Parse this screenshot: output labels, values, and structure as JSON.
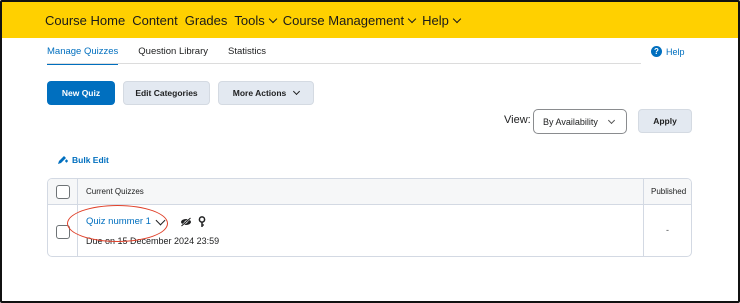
{
  "nav": {
    "items": [
      {
        "label": "Course Home",
        "dropdown": false
      },
      {
        "label": "Content",
        "dropdown": false
      },
      {
        "label": "Grades",
        "dropdown": false
      },
      {
        "label": "Tools",
        "dropdown": true
      },
      {
        "label": "Course Management",
        "dropdown": true
      },
      {
        "label": "Help",
        "dropdown": true
      }
    ]
  },
  "tabs": [
    {
      "label": "Manage Quizzes",
      "active": true
    },
    {
      "label": "Question Library",
      "active": false
    },
    {
      "label": "Statistics",
      "active": false
    }
  ],
  "help": {
    "label": "Help",
    "icon": "question-circle-icon"
  },
  "toolbar": {
    "new_quiz": "New Quiz",
    "edit_categories": "Edit Categories",
    "more_actions": "More Actions"
  },
  "view": {
    "label": "View:",
    "selected": "By Availability",
    "apply": "Apply"
  },
  "bulk_edit": {
    "label": "Bulk Edit",
    "icon": "pencil-edit-icon"
  },
  "table": {
    "headers": {
      "name": "Current Quizzes",
      "published": "Published"
    },
    "rows": [
      {
        "name": "Quiz nummer 1",
        "due": "Due on 15 December 2024 23:59",
        "published": "-",
        "icons": [
          "eye-hidden-icon",
          "key-icon"
        ]
      }
    ]
  },
  "colors": {
    "nav_bg": "#ffd000",
    "primary": "#006fbf",
    "annotation": "#e0412a"
  }
}
